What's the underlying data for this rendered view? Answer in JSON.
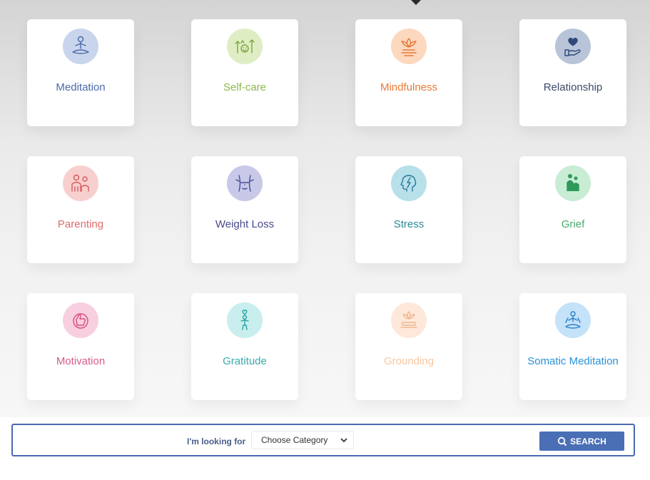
{
  "categories": [
    {
      "label": "Meditation",
      "icon": "meditation-icon",
      "color": "#4a68a8",
      "bg": "#c9d5ec",
      "stroke": "#4a68a8"
    },
    {
      "label": "Self-care",
      "icon": "self-care-icon",
      "color": "#8cba4a",
      "bg": "#dfedc4",
      "stroke": "#7aa83c"
    },
    {
      "label": "Mindfulness",
      "icon": "lotus-icon",
      "color": "#e87a3a",
      "bg": "#fcd8bf",
      "stroke": "#e87a3a"
    },
    {
      "label": "Relationship",
      "icon": "heart-hand-icon",
      "color": "#3a4a6a",
      "bg": "#b8c4d8",
      "stroke": "#2e4a7a"
    },
    {
      "label": "Parenting",
      "icon": "family-icon",
      "color": "#e06a6a",
      "bg": "#f8cfcf",
      "stroke": "#d85a5a"
    },
    {
      "label": "Weight Loss",
      "icon": "waist-icon",
      "color": "#4a4a8a",
      "bg": "#c8c8e8",
      "stroke": "#4a4a9a"
    },
    {
      "label": "Stress",
      "icon": "head-lightning-icon",
      "color": "#2a8a9a",
      "bg": "#b8e0ea",
      "stroke": "#2a7a9a"
    },
    {
      "label": "Grief",
      "icon": "comfort-icon",
      "color": "#4aaa6a",
      "bg": "#c8ecd4",
      "stroke": "#2e9a5a"
    },
    {
      "label": "Motivation",
      "icon": "thumbs-up-icon",
      "color": "#d85a8a",
      "bg": "#f8cfe0",
      "stroke": "#d84a7a"
    },
    {
      "label": "Gratitude",
      "icon": "gratitude-figure-icon",
      "color": "#3aaaaa",
      "bg": "#c8eeee",
      "stroke": "#2aa0a0"
    },
    {
      "label": "Grounding",
      "icon": "grounding-icon",
      "color": "#f6c6a0",
      "bg": "#fde8da",
      "stroke": "#f0b890"
    },
    {
      "label": "Somatic Meditation",
      "icon": "somatic-meditation-icon",
      "color": "#2a90d8",
      "bg": "#c4e2f8",
      "stroke": "#2a80c8"
    }
  ],
  "search": {
    "looking_label": "I'm looking for",
    "select_value": "Choose Category",
    "button_label": "SEARCH"
  }
}
